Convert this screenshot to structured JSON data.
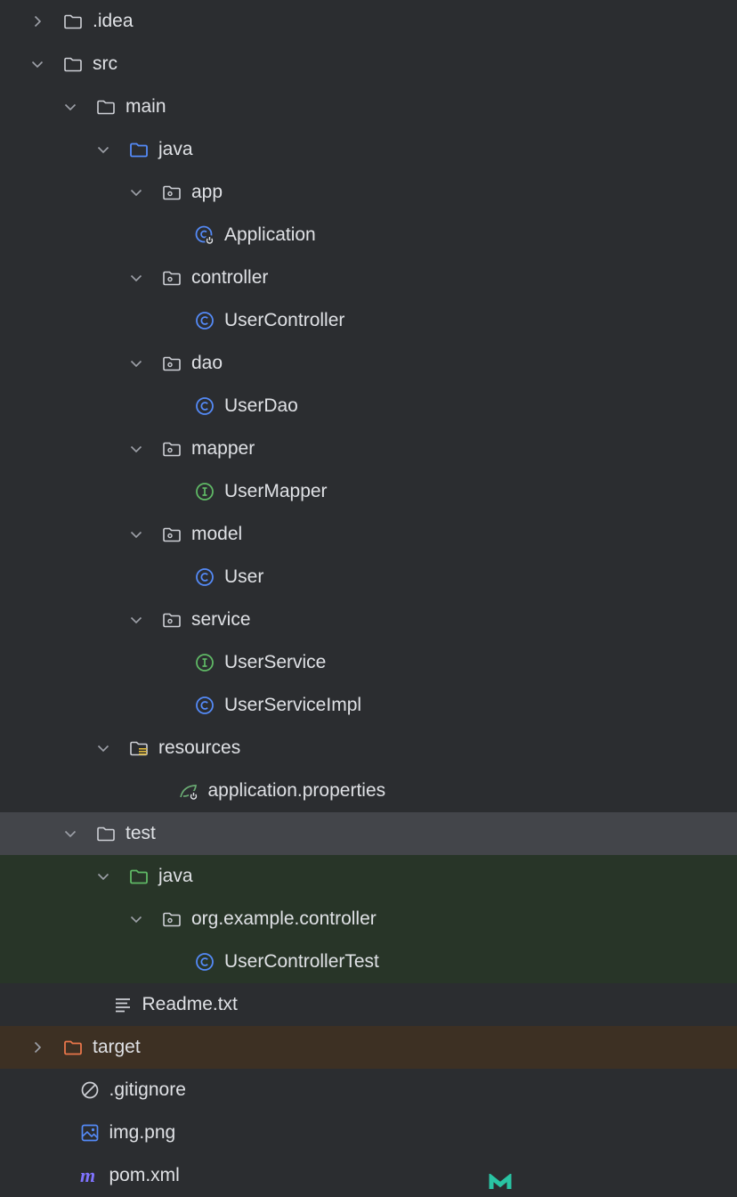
{
  "colors": {
    "background": "#2b2d30",
    "text": "#dfe1e5",
    "selected_row": "#43454a",
    "test_row": "#283528",
    "excluded_row": "#3d3023",
    "folder": "#ced0d6",
    "source_folder": "#548af7",
    "test_folder": "#5fb865",
    "excluded_folder": "#e8754a",
    "class_icon": "#548af7",
    "interface_icon": "#5fb865"
  },
  "tree": [
    {
      "label": ".idea",
      "level": 0,
      "expanded": false,
      "icon": "folder-icon",
      "highlight": ""
    },
    {
      "label": "src",
      "level": 0,
      "expanded": true,
      "icon": "folder-icon",
      "highlight": ""
    },
    {
      "label": "main",
      "level": 1,
      "expanded": true,
      "icon": "folder-icon",
      "highlight": ""
    },
    {
      "label": "java",
      "level": 2,
      "expanded": true,
      "icon": "source-root-folder-icon",
      "highlight": ""
    },
    {
      "label": "app",
      "level": 3,
      "expanded": true,
      "icon": "package-icon",
      "highlight": ""
    },
    {
      "label": "Application",
      "level": 4,
      "icon": "spring-boot-class-icon",
      "highlight": ""
    },
    {
      "label": "controller",
      "level": 3,
      "expanded": true,
      "icon": "package-icon",
      "highlight": ""
    },
    {
      "label": "UserController",
      "level": 4,
      "icon": "class-icon",
      "highlight": ""
    },
    {
      "label": "dao",
      "level": 3,
      "expanded": true,
      "icon": "package-icon",
      "highlight": ""
    },
    {
      "label": "UserDao",
      "level": 4,
      "icon": "class-icon",
      "highlight": ""
    },
    {
      "label": "mapper",
      "level": 3,
      "expanded": true,
      "icon": "package-icon",
      "highlight": ""
    },
    {
      "label": "UserMapper",
      "level": 4,
      "icon": "interface-icon",
      "highlight": ""
    },
    {
      "label": "model",
      "level": 3,
      "expanded": true,
      "icon": "package-icon",
      "highlight": ""
    },
    {
      "label": "User",
      "level": 4,
      "icon": "class-icon",
      "highlight": ""
    },
    {
      "label": "service",
      "level": 3,
      "expanded": true,
      "icon": "package-icon",
      "highlight": ""
    },
    {
      "label": "UserService",
      "level": 4,
      "icon": "interface-icon",
      "highlight": ""
    },
    {
      "label": "UserServiceImpl",
      "level": 4,
      "icon": "class-icon",
      "highlight": ""
    },
    {
      "label": "resources",
      "level": 2,
      "expanded": true,
      "icon": "resources-folder-icon",
      "highlight": ""
    },
    {
      "label": "application.properties",
      "level": 3.5,
      "icon": "spring-properties-icon",
      "highlight": ""
    },
    {
      "label": "test",
      "level": 1,
      "expanded": true,
      "icon": "folder-icon",
      "highlight": "selected"
    },
    {
      "label": "java",
      "level": 2,
      "expanded": true,
      "icon": "test-root-folder-icon",
      "highlight": "test"
    },
    {
      "label": "org.example.controller",
      "level": 3,
      "expanded": true,
      "icon": "package-icon",
      "highlight": "test"
    },
    {
      "label": "UserControllerTest",
      "level": 4,
      "icon": "class-icon",
      "highlight": "test"
    },
    {
      "label": "Readme.txt",
      "level": 1.5,
      "icon": "text-file-icon",
      "highlight": ""
    },
    {
      "label": "target",
      "level": 0,
      "expanded": false,
      "icon": "excluded-folder-icon",
      "highlight": "excluded"
    },
    {
      "label": ".gitignore",
      "level": 0.5,
      "icon": "gitignore-icon",
      "highlight": ""
    },
    {
      "label": "img.png",
      "level": 0.5,
      "icon": "image-file-icon",
      "highlight": ""
    },
    {
      "label": "pom.xml",
      "level": 0.5,
      "icon": "maven-icon",
      "highlight": ""
    }
  ]
}
